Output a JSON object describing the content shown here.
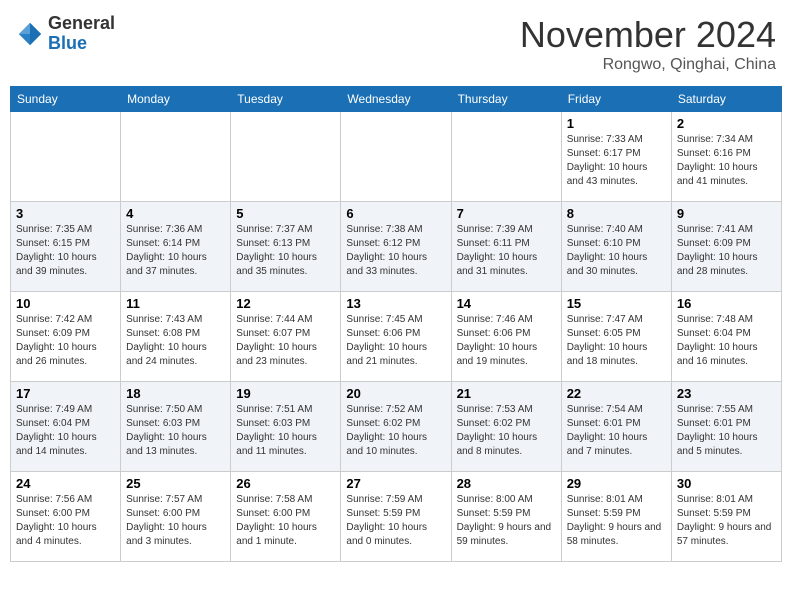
{
  "header": {
    "logo_general": "General",
    "logo_blue": "Blue",
    "month_title": "November 2024",
    "subtitle": "Rongwo, Qinghai, China"
  },
  "days_of_week": [
    "Sunday",
    "Monday",
    "Tuesday",
    "Wednesday",
    "Thursday",
    "Friday",
    "Saturday"
  ],
  "weeks": [
    [
      {
        "day": "",
        "info": ""
      },
      {
        "day": "",
        "info": ""
      },
      {
        "day": "",
        "info": ""
      },
      {
        "day": "",
        "info": ""
      },
      {
        "day": "",
        "info": ""
      },
      {
        "day": "1",
        "info": "Sunrise: 7:33 AM\nSunset: 6:17 PM\nDaylight: 10 hours and 43 minutes."
      },
      {
        "day": "2",
        "info": "Sunrise: 7:34 AM\nSunset: 6:16 PM\nDaylight: 10 hours and 41 minutes."
      }
    ],
    [
      {
        "day": "3",
        "info": "Sunrise: 7:35 AM\nSunset: 6:15 PM\nDaylight: 10 hours and 39 minutes."
      },
      {
        "day": "4",
        "info": "Sunrise: 7:36 AM\nSunset: 6:14 PM\nDaylight: 10 hours and 37 minutes."
      },
      {
        "day": "5",
        "info": "Sunrise: 7:37 AM\nSunset: 6:13 PM\nDaylight: 10 hours and 35 minutes."
      },
      {
        "day": "6",
        "info": "Sunrise: 7:38 AM\nSunset: 6:12 PM\nDaylight: 10 hours and 33 minutes."
      },
      {
        "day": "7",
        "info": "Sunrise: 7:39 AM\nSunset: 6:11 PM\nDaylight: 10 hours and 31 minutes."
      },
      {
        "day": "8",
        "info": "Sunrise: 7:40 AM\nSunset: 6:10 PM\nDaylight: 10 hours and 30 minutes."
      },
      {
        "day": "9",
        "info": "Sunrise: 7:41 AM\nSunset: 6:09 PM\nDaylight: 10 hours and 28 minutes."
      }
    ],
    [
      {
        "day": "10",
        "info": "Sunrise: 7:42 AM\nSunset: 6:09 PM\nDaylight: 10 hours and 26 minutes."
      },
      {
        "day": "11",
        "info": "Sunrise: 7:43 AM\nSunset: 6:08 PM\nDaylight: 10 hours and 24 minutes."
      },
      {
        "day": "12",
        "info": "Sunrise: 7:44 AM\nSunset: 6:07 PM\nDaylight: 10 hours and 23 minutes."
      },
      {
        "day": "13",
        "info": "Sunrise: 7:45 AM\nSunset: 6:06 PM\nDaylight: 10 hours and 21 minutes."
      },
      {
        "day": "14",
        "info": "Sunrise: 7:46 AM\nSunset: 6:06 PM\nDaylight: 10 hours and 19 minutes."
      },
      {
        "day": "15",
        "info": "Sunrise: 7:47 AM\nSunset: 6:05 PM\nDaylight: 10 hours and 18 minutes."
      },
      {
        "day": "16",
        "info": "Sunrise: 7:48 AM\nSunset: 6:04 PM\nDaylight: 10 hours and 16 minutes."
      }
    ],
    [
      {
        "day": "17",
        "info": "Sunrise: 7:49 AM\nSunset: 6:04 PM\nDaylight: 10 hours and 14 minutes."
      },
      {
        "day": "18",
        "info": "Sunrise: 7:50 AM\nSunset: 6:03 PM\nDaylight: 10 hours and 13 minutes."
      },
      {
        "day": "19",
        "info": "Sunrise: 7:51 AM\nSunset: 6:03 PM\nDaylight: 10 hours and 11 minutes."
      },
      {
        "day": "20",
        "info": "Sunrise: 7:52 AM\nSunset: 6:02 PM\nDaylight: 10 hours and 10 minutes."
      },
      {
        "day": "21",
        "info": "Sunrise: 7:53 AM\nSunset: 6:02 PM\nDaylight: 10 hours and 8 minutes."
      },
      {
        "day": "22",
        "info": "Sunrise: 7:54 AM\nSunset: 6:01 PM\nDaylight: 10 hours and 7 minutes."
      },
      {
        "day": "23",
        "info": "Sunrise: 7:55 AM\nSunset: 6:01 PM\nDaylight: 10 hours and 5 minutes."
      }
    ],
    [
      {
        "day": "24",
        "info": "Sunrise: 7:56 AM\nSunset: 6:00 PM\nDaylight: 10 hours and 4 minutes."
      },
      {
        "day": "25",
        "info": "Sunrise: 7:57 AM\nSunset: 6:00 PM\nDaylight: 10 hours and 3 minutes."
      },
      {
        "day": "26",
        "info": "Sunrise: 7:58 AM\nSunset: 6:00 PM\nDaylight: 10 hours and 1 minute."
      },
      {
        "day": "27",
        "info": "Sunrise: 7:59 AM\nSunset: 5:59 PM\nDaylight: 10 hours and 0 minutes."
      },
      {
        "day": "28",
        "info": "Sunrise: 8:00 AM\nSunset: 5:59 PM\nDaylight: 9 hours and 59 minutes."
      },
      {
        "day": "29",
        "info": "Sunrise: 8:01 AM\nSunset: 5:59 PM\nDaylight: 9 hours and 58 minutes."
      },
      {
        "day": "30",
        "info": "Sunrise: 8:01 AM\nSunset: 5:59 PM\nDaylight: 9 hours and 57 minutes."
      }
    ]
  ]
}
